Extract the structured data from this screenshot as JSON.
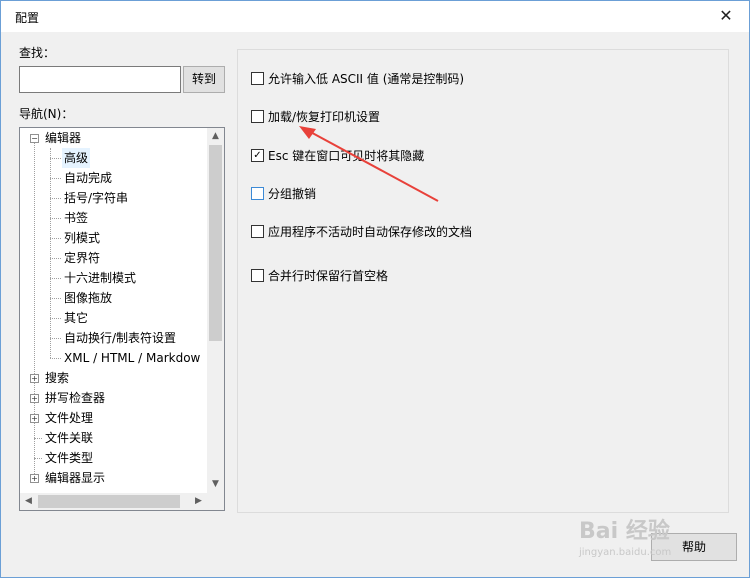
{
  "window": {
    "title": "配置",
    "close_glyph": "✕"
  },
  "search": {
    "label": "查找：",
    "value": "",
    "placeholder": "",
    "goto_button": "转到"
  },
  "nav": {
    "label": "导航(N)：",
    "tree": [
      {
        "label": "编辑器",
        "level": 0,
        "expanded": true,
        "selected": false
      },
      {
        "label": "高级",
        "level": 1,
        "selected": true
      },
      {
        "label": "自动完成",
        "level": 1,
        "selected": false
      },
      {
        "label": "括号/字符串",
        "level": 1,
        "selected": false
      },
      {
        "label": "书签",
        "level": 1,
        "selected": false
      },
      {
        "label": "列模式",
        "level": 1,
        "selected": false
      },
      {
        "label": "定界符",
        "level": 1,
        "selected": false
      },
      {
        "label": "十六进制模式",
        "level": 1,
        "selected": false
      },
      {
        "label": "图像拖放",
        "level": 1,
        "selected": false
      },
      {
        "label": "其它",
        "level": 1,
        "selected": false
      },
      {
        "label": "自动换行/制表符设置",
        "level": 1,
        "selected": false
      },
      {
        "label": "XML / HTML / Markdow",
        "level": 1,
        "selected": false
      },
      {
        "label": "搜索",
        "level": 0,
        "expanded": false,
        "selected": false
      },
      {
        "label": "拼写检查器",
        "level": 0,
        "expanded": false,
        "selected": false
      },
      {
        "label": "文件处理",
        "level": 0,
        "expanded": false,
        "selected": false
      },
      {
        "label": "文件关联",
        "level": 0,
        "leaf": true,
        "selected": false
      },
      {
        "label": "文件类型",
        "level": 0,
        "leaf": true,
        "selected": false
      },
      {
        "label": "编辑器显示",
        "level": 0,
        "expanded": false,
        "selected": false
      }
    ]
  },
  "options": [
    {
      "label": "允许输入低 ASCII 值 (通常是控制码)",
      "checked": false,
      "focused": false
    },
    {
      "label": "加载/恢复打印机设置",
      "checked": false,
      "focused": false
    },
    {
      "label": "Esc 键在窗口可见时将其隐藏",
      "checked": true,
      "focused": false
    },
    {
      "label": "分组撤销",
      "checked": false,
      "focused": true
    },
    {
      "label": "应用程序不活动时自动保存修改的文档",
      "checked": false,
      "focused": false
    },
    {
      "label": "合并行时保留行首空格",
      "checked": false,
      "focused": false
    }
  ],
  "help_button": "帮助",
  "watermark": {
    "brand": "Bai 经验",
    "site": "jingyan.baidu.com"
  },
  "colors": {
    "annotation_arrow": "#e8413a",
    "selection": "#e5f3ff",
    "focus_border": "#3c8ad6"
  }
}
